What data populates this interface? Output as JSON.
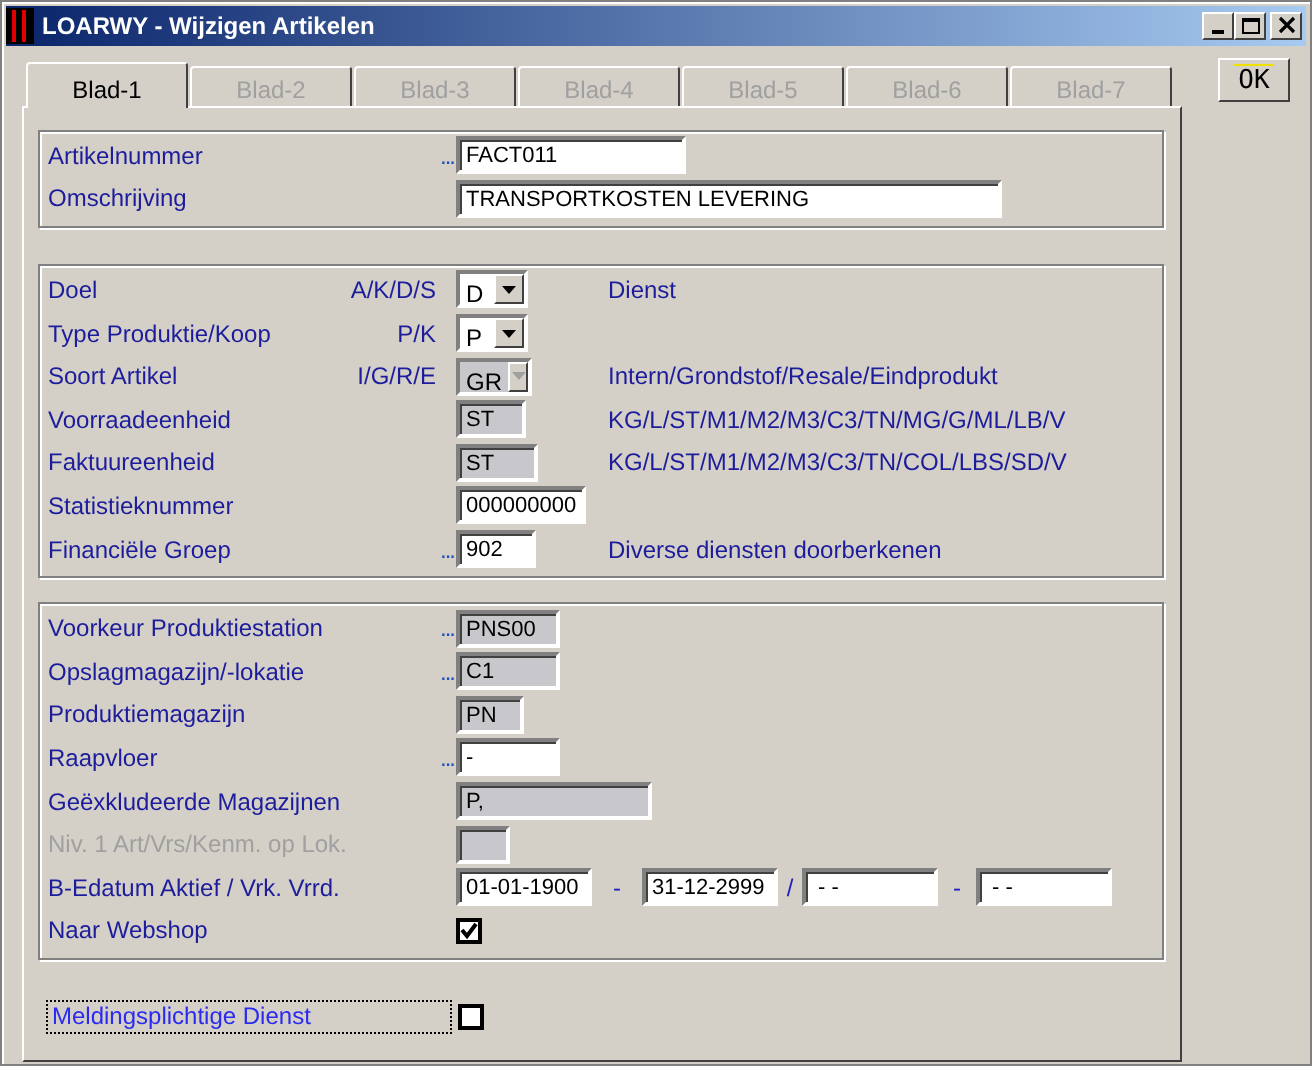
{
  "window": {
    "title": "LOARWY - Wijzigen Artikelen"
  },
  "tabs": [
    {
      "label": "Blad-1",
      "selected": true
    },
    {
      "label": "Blad-2",
      "selected": false
    },
    {
      "label": "Blad-3",
      "selected": false
    },
    {
      "label": "Blad-4",
      "selected": false
    },
    {
      "label": "Blad-5",
      "selected": false
    },
    {
      "label": "Blad-6",
      "selected": false
    },
    {
      "label": "Blad-7",
      "selected": false
    }
  ],
  "ok_button": "OK",
  "sections": [
    {
      "rows": [
        {
          "label": "Artikelnummer",
          "lookup": "...",
          "field": {
            "kind": "text",
            "value": "FACT011",
            "readonly": false
          }
        },
        {
          "label": "Omschrijving",
          "field": {
            "kind": "text",
            "value": "TRANSPORTKOSTEN LEVERING",
            "readonly": false
          }
        }
      ]
    },
    {
      "rows": [
        {
          "label": "Doel",
          "hint": "A/K/D/S",
          "field": {
            "kind": "select",
            "value": "D",
            "readonly": false
          },
          "description": "Dienst"
        },
        {
          "label": "Type Produktie/Koop",
          "hint": "P/K",
          "field": {
            "kind": "select",
            "value": "P",
            "readonly": false
          }
        },
        {
          "label": "Soort Artikel",
          "hint": "I/G/R/E",
          "field": {
            "kind": "select",
            "value": "GR",
            "readonly": true
          },
          "description": "Intern/Grondstof/Resale/Eindprodukt"
        },
        {
          "label": "Voorraadeenheid",
          "field": {
            "kind": "text",
            "value": "ST",
            "readonly": true
          },
          "description": "KG/L/ST/M1/M2/M3/C3/TN/MG/G/ML/LB/V"
        },
        {
          "label": "Faktuureenheid",
          "field": {
            "kind": "text",
            "value": "ST",
            "readonly": true
          },
          "description": "KG/L/ST/M1/M2/M3/C3/TN/COL/LBS/SD/V"
        },
        {
          "label": "Statistieknummer",
          "field": {
            "kind": "text",
            "value": "000000000",
            "readonly": false
          }
        },
        {
          "label": "Financiële Groep",
          "lookup": "...",
          "field": {
            "kind": "text",
            "value": "902",
            "readonly": false
          },
          "description": "Diverse diensten doorberkenen"
        }
      ]
    },
    {
      "rows": [
        {
          "label": "Voorkeur Produktiestation",
          "lookup": "...",
          "field": {
            "kind": "text",
            "value": "PNS00",
            "readonly": true
          }
        },
        {
          "label": "Opslagmagazijn/-lokatie",
          "lookup": "...",
          "field": {
            "kind": "text",
            "value": "C1",
            "readonly": true
          }
        },
        {
          "label": "Produktiemagazijn",
          "field": {
            "kind": "text",
            "value": "PN",
            "readonly": true
          }
        },
        {
          "label": "Raapvloer",
          "lookup": "...",
          "field": {
            "kind": "text",
            "value": "-",
            "readonly": false
          }
        },
        {
          "label": "Geëxkludeerde Magazijnen",
          "field": {
            "kind": "text",
            "value": "P,",
            "readonly": true
          }
        },
        {
          "label": "Niv. 1 Art/Vrs/Kenm. op Lok.",
          "disabled": true,
          "field": {
            "kind": "text",
            "readonly": true
          }
        },
        {
          "label": "B-Edatum Aktief / Vrk. Vrrd.",
          "field": {
            "kind": "dates",
            "values": [
              "01-01-1900",
              "31-12-2999",
              " - -",
              " - -"
            ],
            "separators": [
              "-",
              "/",
              "-"
            ]
          }
        },
        {
          "label": "Naar Webshop",
          "field": {
            "kind": "checkbox",
            "checked": true
          }
        }
      ]
    }
  ],
  "bottom": {
    "label": "Meldingsplichtige Dienst",
    "checked": false
  }
}
